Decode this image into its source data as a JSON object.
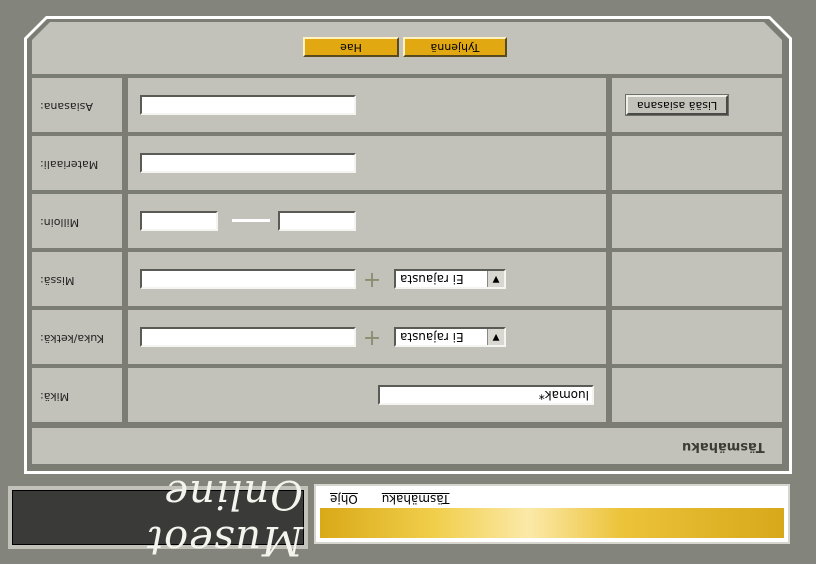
{
  "app": {
    "logo_text": "Museot Online"
  },
  "nav": {
    "links": [
      "Täsmähaku",
      "Ohje"
    ]
  },
  "form": {
    "title": "Täsmähaku",
    "fields": {
      "mika": {
        "label": "Mikä:",
        "value": "luomak*"
      },
      "kuka": {
        "label": "Kuka/ketkä:",
        "value": "",
        "select_value": "Ei rajausta"
      },
      "missa": {
        "label": "Missä:",
        "value": "",
        "select_value": "Ei rajausta"
      },
      "milloin": {
        "label": "Milloin:",
        "from": "",
        "to": ""
      },
      "materiaali": {
        "label": "Materiaali:",
        "value": ""
      },
      "asiasana": {
        "label": "Asiasana:",
        "value": ""
      }
    },
    "add_keyword_label": "Lisää asiasana",
    "buttons": {
      "clear": "Tyhjennä",
      "search": "Hae"
    }
  },
  "colors": {
    "background": "#83847c",
    "panel": "#c2c2ba",
    "accent_button": "#e1a812",
    "banner_gold": "#ecc33a"
  }
}
